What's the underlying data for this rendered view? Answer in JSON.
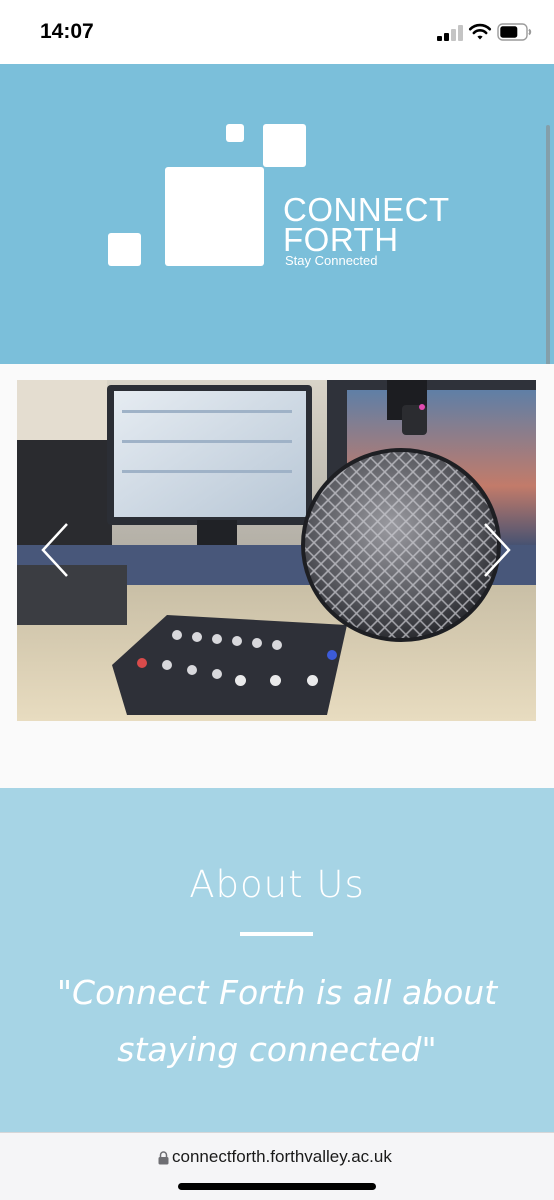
{
  "status_bar": {
    "time": "14:07",
    "icons": [
      "signal-icon",
      "wifi-icon",
      "battery-icon"
    ]
  },
  "header": {
    "logo_line1": "CONNECT",
    "logo_line2": "FORTH",
    "tagline": "Stay Connected",
    "background_color": "#7bbfda"
  },
  "carousel": {
    "slide_image": "radio-studio-microphone-photo",
    "prev_icon": "chevron-left-icon",
    "next_icon": "chevron-right-icon",
    "slide_count": 3
  },
  "about": {
    "title": "About Us",
    "quote": "\"Connect Forth is all about staying connected\"",
    "background_color": "#a6d4e5"
  },
  "browser": {
    "url": "connectforth.forthvalley.ac.uk",
    "lock_icon": "lock-icon"
  }
}
